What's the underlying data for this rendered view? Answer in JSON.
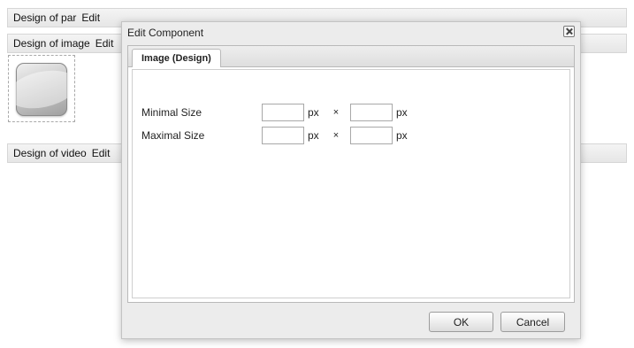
{
  "background": {
    "bars": [
      {
        "label": "Design of par",
        "edit": "Edit"
      },
      {
        "label": "Design of image",
        "edit": "Edit"
      },
      {
        "label": "Design of video",
        "edit": "Edit"
      }
    ]
  },
  "dialog": {
    "title": "Edit Component",
    "tab": "Image (Design)",
    "rows": [
      {
        "label": "Minimal Size",
        "width_value": "",
        "height_value": "",
        "unit": "px",
        "separator": "×"
      },
      {
        "label": "Maximal Size",
        "width_value": "",
        "height_value": "",
        "unit": "px",
        "separator": "×"
      }
    ],
    "buttons": {
      "ok": "OK",
      "cancel": "Cancel"
    }
  },
  "colors": {
    "bar_bg": "#ececec",
    "dialog_bg": "#ececec",
    "panel_bg": "#ffffff"
  },
  "icons": [
    "close-icon",
    "image-placeholder-icon"
  ]
}
